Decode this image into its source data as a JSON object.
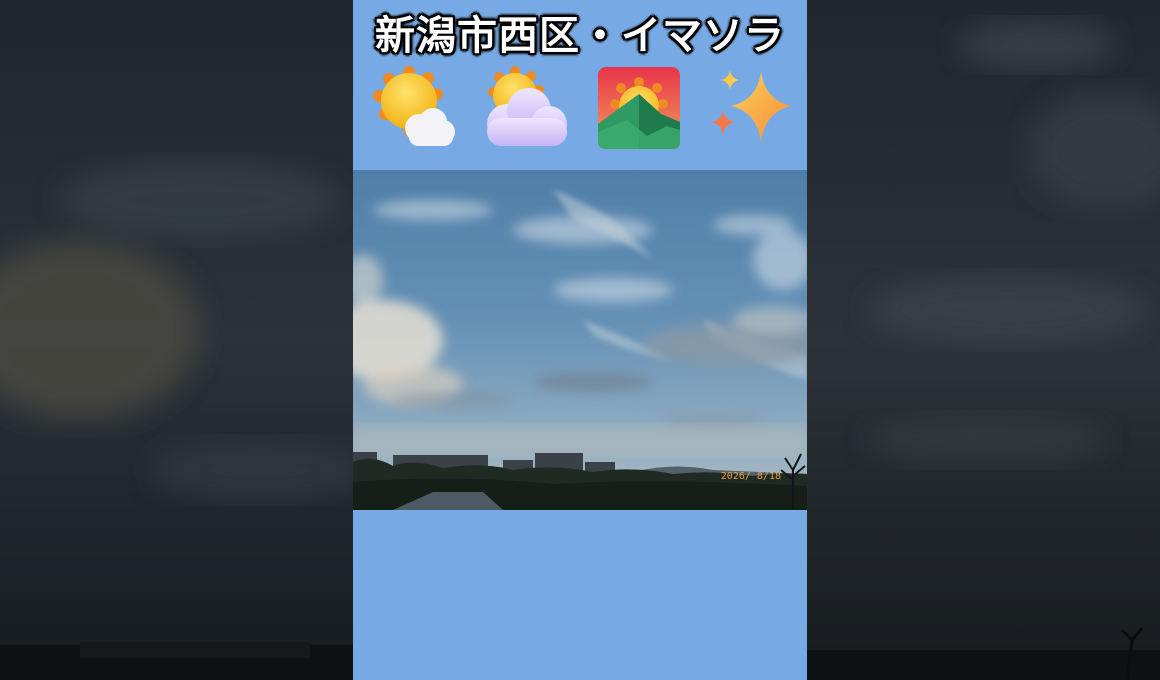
{
  "title": "新潟市西区・イマソラ",
  "icons": [
    {
      "name": "sun-behind-small-cloud"
    },
    {
      "name": "sun-behind-large-cloud"
    },
    {
      "name": "sunrise-over-mountains"
    },
    {
      "name": "sparkles"
    }
  ],
  "photo": {
    "date_stamp": "2026/ 8/18"
  },
  "colors": {
    "panel_background": "#77aae4",
    "sky_top": "#4f7ea8",
    "sky_horizon": "#9fb3c2",
    "date_stamp": "#e8a24a"
  }
}
